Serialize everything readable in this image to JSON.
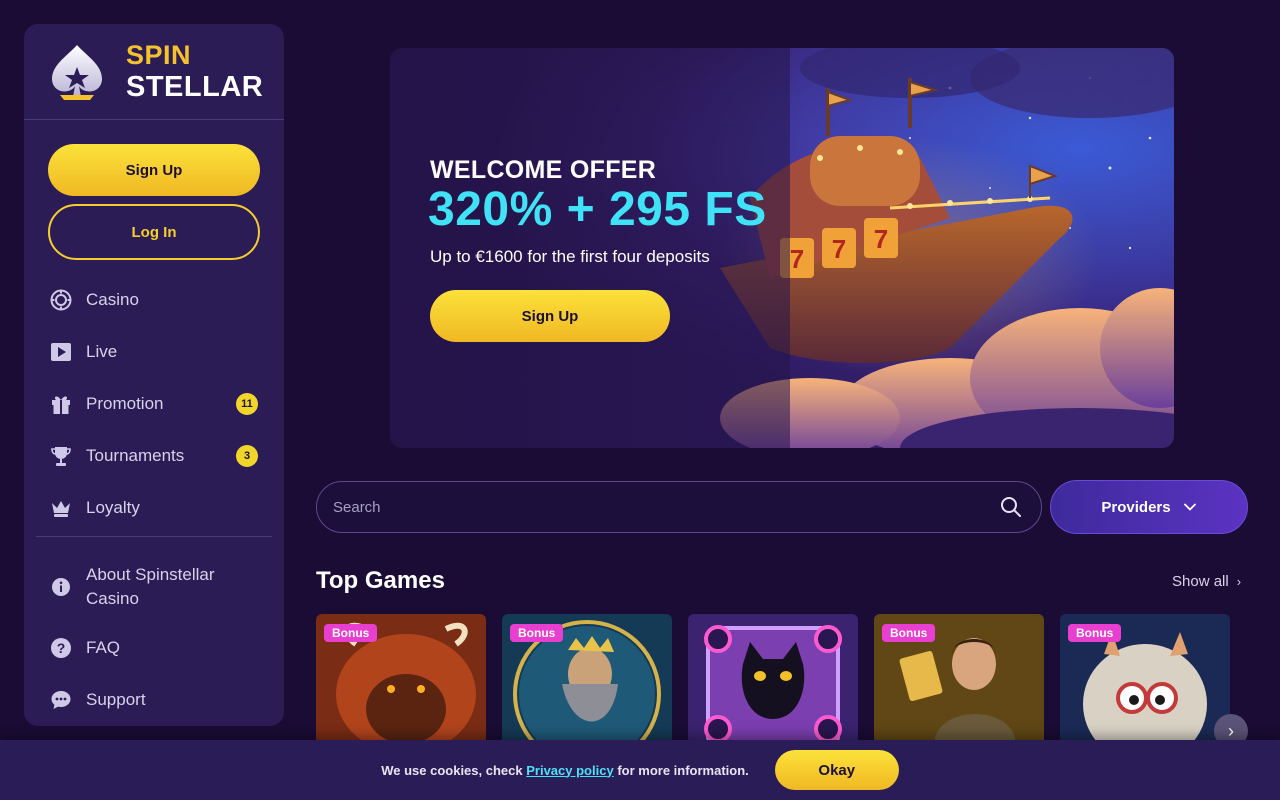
{
  "brand": {
    "line1": "SPIN",
    "line2": "STELLAR"
  },
  "sidebar": {
    "signup_label": "Sign Up",
    "login_label": "Log In",
    "items": [
      {
        "label": "Casino",
        "icon": "casino-chip-icon"
      },
      {
        "label": "Live",
        "icon": "play-icon"
      },
      {
        "label": "Promotion",
        "icon": "gift-icon",
        "badge": "11"
      },
      {
        "label": "Tournaments",
        "icon": "trophy-icon",
        "badge": "3"
      },
      {
        "label": "Loyalty",
        "icon": "crown-icon"
      }
    ],
    "secondary": [
      {
        "label": "About Spinstellar Casino",
        "icon": "info-icon"
      },
      {
        "label": "FAQ",
        "icon": "question-icon"
      },
      {
        "label": "Support",
        "icon": "chat-icon"
      }
    ]
  },
  "hero": {
    "kicker": "WELCOME OFFER",
    "amount": "320% + 295 FS",
    "subtitle": "Up to €1600 for the first four deposits",
    "cta": "Sign Up"
  },
  "search": {
    "placeholder": "Search"
  },
  "providers_label": "Providers",
  "top_games": {
    "title": "Top Games",
    "show_all": "Show all",
    "games": [
      {
        "tag": "Bonus",
        "theme": "buffalo"
      },
      {
        "tag": "Bonus",
        "theme": "zeus"
      },
      {
        "tag": "",
        "theme": "black-cat"
      },
      {
        "tag": "Bonus",
        "theme": "explorer"
      },
      {
        "tag": "Bonus",
        "theme": "monster"
      }
    ]
  },
  "cookie": {
    "text_before": "We use cookies, check",
    "link": "Privacy policy",
    "text_after": "for more information.",
    "ok": "Okay"
  },
  "colors": {
    "background": "#1a0c35",
    "sidebar": "#2b1c55",
    "accent_yellow": "#f5cf2e",
    "accent_cyan": "#40e3f5",
    "bonus_tag": "#e93fd0"
  }
}
